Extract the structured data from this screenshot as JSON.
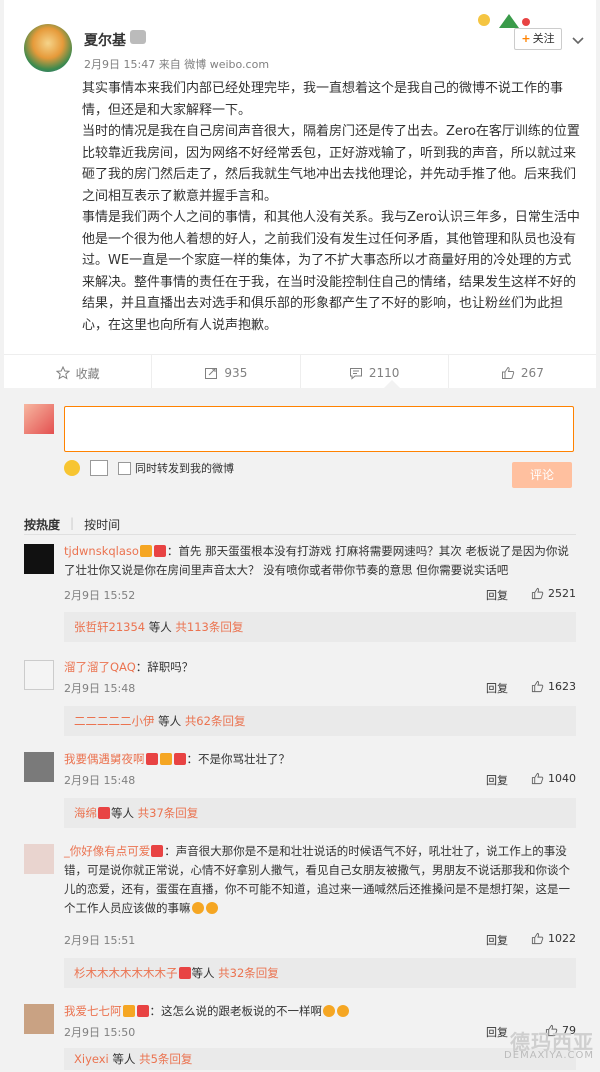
{
  "post": {
    "username": "夏尔基",
    "time": "2月9日 15:47",
    "source_prefix": "来自",
    "source": "微博 weibo.com",
    "follow_label": "关注",
    "paragraphs": [
      "其实事情本来我们内部已经处理完毕，我一直想着这个是我自己的微博不说工作的事情，但还是和大家解释一下。",
      "当时的情况是我在自己房间声音很大，隔着房门还是传了出去。Zero在客厅训练的位置比较靠近我房间，因为网络不好经常丢包，正好游戏输了，听到我的声音，所以就过来砸了我的房门然后走了，然后我就生气地冲出去找他理论，并先动手推了他。后来我们之间相互表示了歉意并握手言和。",
      "事情是我们两个人之间的事情，和其他人没有关系。我与Zero认识三年多，日常生活中他是一个很为他人着想的好人，之前我们没有发生过任何矛盾，其他管理和队员也没有过。WE一直是一个家庭一样的集体，为了不扩大事态所以才商量好用的冷处理的方式来解决。整件事情的责任在于我，在当时没能控制住自己的情绪，结果发生这样不好的结果，并且直播出去对选手和俱乐部的形象都产生了不好的影响，也让粉丝们为此担心，在这里也向所有人说声抱歉。"
    ],
    "actions": {
      "favorite": "收藏",
      "repost": "935",
      "comment": "2110",
      "like": "267"
    }
  },
  "composer": {
    "forward_label": "同时转发到我的微博",
    "submit_label": "评论"
  },
  "sort": {
    "hot": "按热度",
    "time": "按时间"
  },
  "comments": [
    {
      "name": "tjdwnskqlaso",
      "text": "：首先 那天蛋蛋根本没有打游戏 打麻将需要网速吗？其次 老板说了是因为你说了壮壮你又说是你在房间里声音太大？ 没有喷你或者带你节奏的意思 但你需要说实话吧",
      "time": "2月9日 15:52",
      "reply": "回复",
      "likes": "2521",
      "sub_name": "张哲轩21354",
      "sub_mid": " 等人 ",
      "sub_count": "共113条回复"
    },
    {
      "name": "溜了溜了QAQ",
      "text": "：辞职吗？",
      "time": "2月9日 15:48",
      "reply": "回复",
      "likes": "1623",
      "sub_name": "二二二二二小伊",
      "sub_mid": " 等人 ",
      "sub_count": "共62条回复"
    },
    {
      "name": "我要偶遇舅夜啊",
      "text": "：不是你骂壮壮了？",
      "time": "2月9日 15:48",
      "reply": "回复",
      "likes": "1040",
      "sub_name": "海绵",
      "sub_mid": "等人 ",
      "sub_count": "共37条回复"
    },
    {
      "name": "_你好像有点可爱",
      "text": "：声音很大那你是不是和壮壮说话的时候语气不好，吼壮壮了，说工作上的事没错，可是说你就正常说，心情不好拿别人撒气，看见自己女朋友被撒气，男朋友不说话那我和你谈个儿的恋爱，还有，蛋蛋在直播，你不可能不知道，追过来一通喊然后还推搡问是不是想打架，这是一个工作人员应该做的事嘛",
      "time": "2月9日 15:51",
      "reply": "回复",
      "likes": "1022",
      "sub_name": "杉木木木木木木木子",
      "sub_mid": "等人 ",
      "sub_count": "共32条回复"
    },
    {
      "name": "我爱七七阿",
      "text": "：这怎么说的跟老板说的不一样啊",
      "time": "2月9日 15:50",
      "reply": "回复",
      "likes": "79",
      "sub_name": "Xiyexi",
      "sub_mid": " 等人 ",
      "sub_count": "共5条回复"
    }
  ],
  "watermark": {
    "main": "德玛西亚",
    "sub": "DEMAXIYA.COM"
  },
  "colors": {
    "accent": "#ff8200",
    "name": "#eb7350",
    "submit": "#ffc09f"
  }
}
